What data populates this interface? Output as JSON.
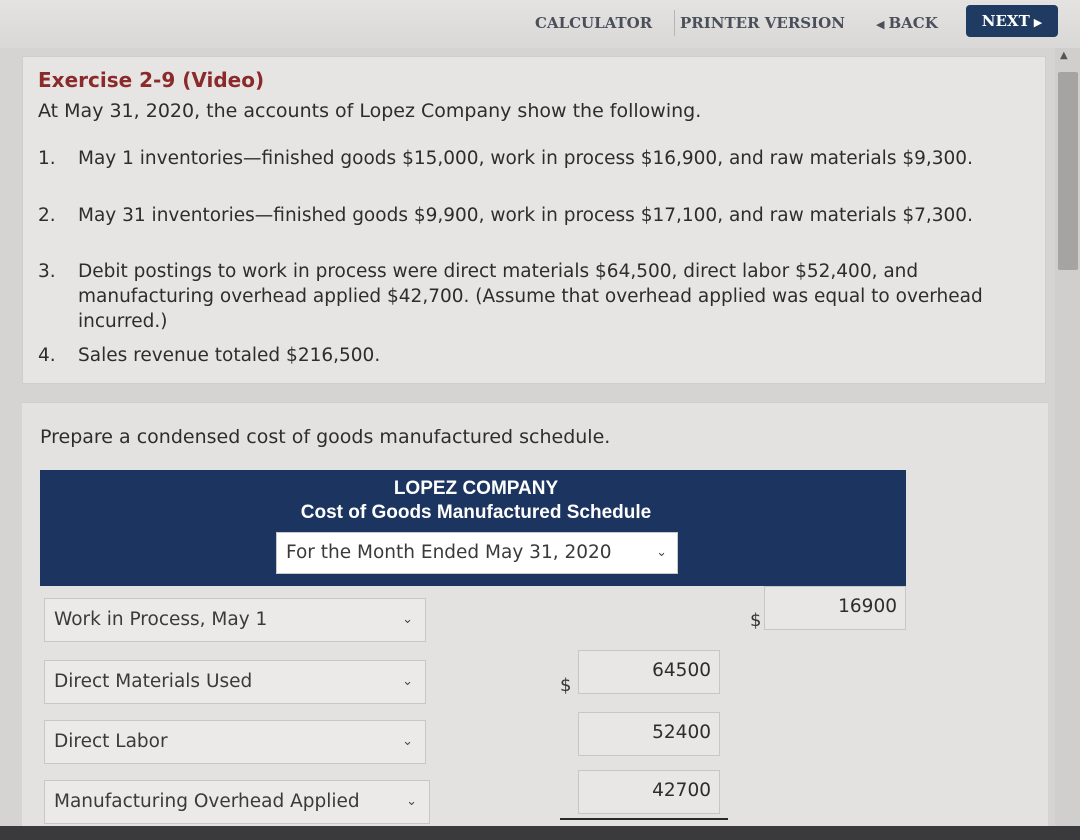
{
  "toolbar": {
    "calculator": "CALCULATOR",
    "printer_version": "PRINTER VERSION",
    "back": "BACK",
    "next": "NEXT",
    "back_icon": "chevron-left-icon",
    "next_icon": "chevron-right-icon"
  },
  "exercise": {
    "title": "Exercise 2-9 (Video)",
    "intro": "At May 31, 2020, the accounts of Lopez Company show the following.",
    "items": [
      {
        "num": "1.",
        "text": "May 1 inventories—finished goods $15,000, work in process $16,900, and raw materials $9,300."
      },
      {
        "num": "2.",
        "text": "May 31 inventories—finished goods $9,900, work in process $17,100, and raw materials $7,300."
      },
      {
        "num": "3.",
        "text": "Debit postings to work in process were direct materials $64,500, direct labor $52,400, and manufacturing overhead applied $42,700. (Assume that overhead applied was equal to overhead incurred.)"
      },
      {
        "num": "4.",
        "text": "Sales revenue totaled $216,500."
      }
    ]
  },
  "task": {
    "prompt": "Prepare a condensed cost of goods manufactured schedule."
  },
  "schedule": {
    "company": "LOPEZ COMPANY",
    "title": "Cost of Goods Manufactured Schedule",
    "period": "For the Month Ended May 31, 2020",
    "rows": [
      {
        "label": "Work in Process, May 1",
        "value": "16900",
        "currency": "$"
      },
      {
        "label": "Direct Materials Used",
        "value": "64500",
        "currency": "$"
      },
      {
        "label": "Direct Labor",
        "value": "52400"
      },
      {
        "label": "Manufacturing Overhead Applied",
        "value": "42700"
      }
    ]
  }
}
